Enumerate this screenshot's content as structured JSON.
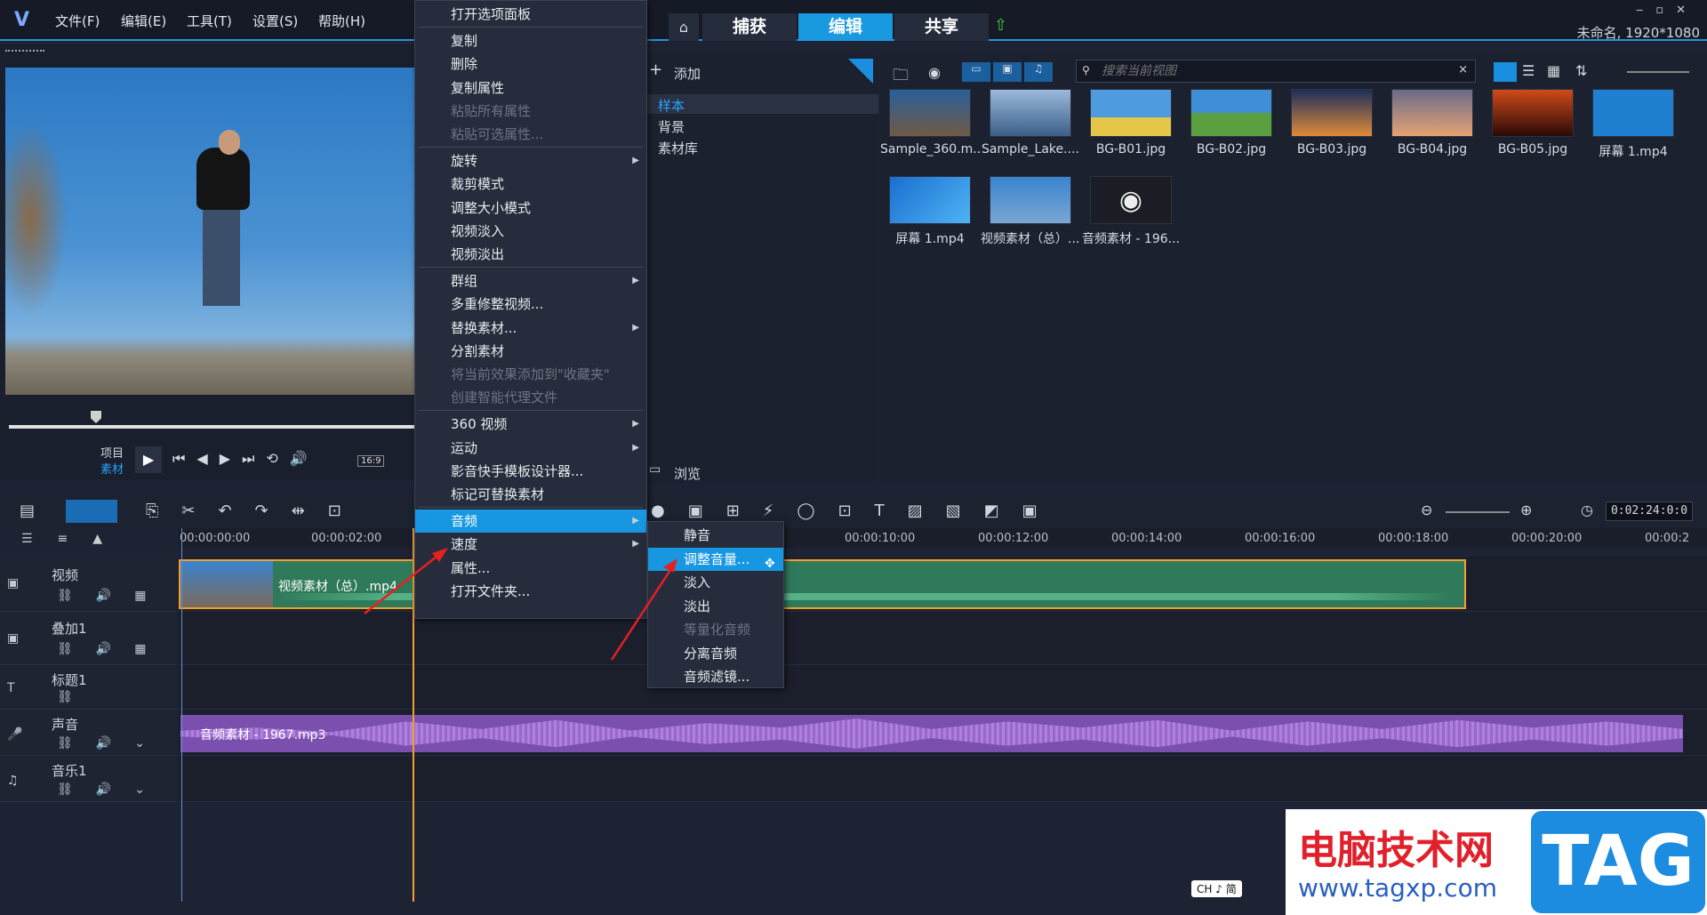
{
  "menubar": {
    "items": [
      "文件(F)",
      "编辑(E)",
      "工具(T)",
      "设置(S)",
      "帮助(H)"
    ]
  },
  "tabs": {
    "capture": "捕获",
    "edit": "编辑",
    "share": "共享"
  },
  "project_info": "未命名, 1920*1080",
  "player": {
    "project_label": "项目",
    "clip_label": "素材",
    "ratio": "16:9"
  },
  "context_menu": {
    "items": [
      {
        "label": "打开选项面板",
        "disabled": false
      },
      {
        "label": "复制",
        "disabled": false
      },
      {
        "label": "删除",
        "disabled": false
      },
      {
        "label": "复制属性",
        "disabled": false
      },
      {
        "label": "粘贴所有属性",
        "disabled": true
      },
      {
        "label": "粘贴可选属性...",
        "disabled": true
      },
      {
        "label": "旋转",
        "disabled": false,
        "sub": true
      },
      {
        "label": "裁剪模式",
        "disabled": false
      },
      {
        "label": "调整大小模式",
        "disabled": false
      },
      {
        "label": "视频淡入",
        "disabled": false
      },
      {
        "label": "视频淡出",
        "disabled": false
      },
      {
        "label": "群组",
        "disabled": false,
        "sub": true
      },
      {
        "label": "多重修整视频...",
        "disabled": false
      },
      {
        "label": "替换素材...",
        "disabled": false,
        "sub": true
      },
      {
        "label": "分割素材",
        "disabled": false
      },
      {
        "label": "将当前效果添加到\"收藏夹\"",
        "disabled": true
      },
      {
        "label": "创建智能代理文件",
        "disabled": true
      },
      {
        "label": "360 视频",
        "disabled": false,
        "sub": true
      },
      {
        "label": "运动",
        "disabled": false,
        "sub": true
      },
      {
        "label": "影音快手模板设计器...",
        "disabled": false
      },
      {
        "label": "标记可替换素材",
        "disabled": false
      },
      {
        "label": "音频",
        "disabled": false,
        "sub": true,
        "highlight": true
      },
      {
        "label": "速度",
        "disabled": false,
        "sub": true
      },
      {
        "label": "属性...",
        "disabled": false
      },
      {
        "label": "打开文件夹...",
        "disabled": false
      }
    ]
  },
  "audio_submenu": {
    "items": [
      {
        "label": "静音",
        "disabled": false
      },
      {
        "label": "调整音量...",
        "disabled": false,
        "highlight": true
      },
      {
        "label": "淡入",
        "disabled": false
      },
      {
        "label": "淡出",
        "disabled": false
      },
      {
        "label": "等量化音频",
        "disabled": true
      },
      {
        "label": "分离音频",
        "disabled": false
      },
      {
        "label": "音频滤镜...",
        "disabled": false
      }
    ]
  },
  "library": {
    "add_label": "添加",
    "folders": [
      "样本",
      "背景",
      "素材库"
    ],
    "browse_label": "浏览",
    "search_placeholder": "搜索当前视图",
    "thumbs": [
      {
        "caption": "Sample_360.m...",
        "color": "#3b5f8a"
      },
      {
        "caption": "Sample_Lake....",
        "color": "#6b8fb3"
      },
      {
        "caption": "BG-B01.jpg",
        "color": "#4e8ecb"
      },
      {
        "caption": "BG-B02.jpg",
        "color": "#5aa04a"
      },
      {
        "caption": "BG-B03.jpg",
        "color": "#c6733a"
      },
      {
        "caption": "BG-B04.jpg",
        "color": "#d59a6a"
      },
      {
        "caption": "BG-B05.jpg",
        "color": "#b23a1f"
      },
      {
        "caption": "屏幕 1.mp4",
        "color": "#1f7fd0"
      },
      {
        "caption": "屏幕 1.mp4",
        "color": "#2a8fe0"
      },
      {
        "caption": "视频素材（总）....",
        "color": "#4a8fd0"
      },
      {
        "caption": "音频素材 - 196...",
        "color": "#222"
      }
    ]
  },
  "timeline": {
    "timecode": "0:02:24:0:0",
    "ruler": [
      "00:00:00:00",
      "00:00:02:00",
      "00:00:10:00",
      "00:00:12:00",
      "00:00:14:00",
      "00:00:16:00",
      "00:00:18:00",
      "00:00:20:00",
      "00:00:2"
    ],
    "tracks": [
      "视频",
      "叠加1",
      "标题1",
      "声音",
      "音乐1"
    ],
    "video_clip": "视频素材（总）.mp4",
    "audio_clip": "音频素材 - 1967.mp3"
  },
  "ime": "CH ♪ 简",
  "watermark": {
    "title": "电脑技术网",
    "url": "www.tagxp.com",
    "tag": "TAG"
  }
}
